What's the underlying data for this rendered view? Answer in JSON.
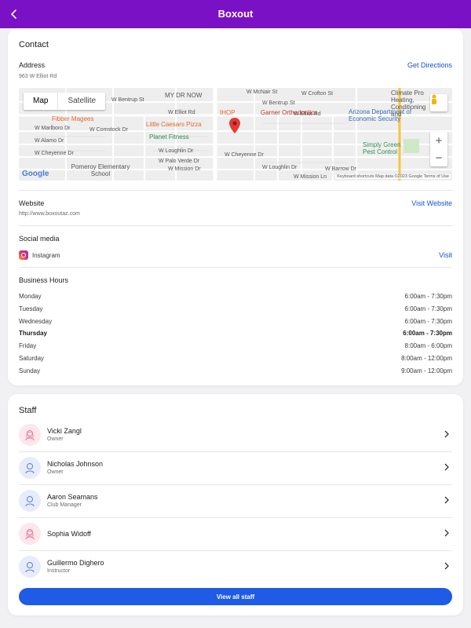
{
  "header": {
    "title": "Boxout"
  },
  "contact": {
    "section_title": "Contact",
    "address_label": "Address",
    "address_value": "963 W Elliot Rd",
    "directions_link": "Get Directions",
    "map": {
      "toggle_map": "Map",
      "toggle_satellite": "Satellite",
      "zoom_in": "+",
      "zoom_out": "−",
      "street_labels": [
        "W Bentrup St",
        "W Elliot Rd",
        "W Comstock Dr",
        "W Marlboro Dr",
        "W Alamo Dr",
        "W Cheyenne Dr",
        "W Loughlin Dr",
        "W Palo Verde Dr",
        "W Mission Dr",
        "W Crofton St",
        "W Bentrup St",
        "W Elliot Rd",
        "W Cheyenne Dr",
        "W Loughlin Dr",
        "W Mission Ln",
        "W Barrow Dr",
        "W McNair St"
      ],
      "pois": [
        "MY DR NOW",
        "IHOP",
        "Garner Orthodontics",
        "Fibber Magees",
        "Little Caesars Pizza",
        "Planet Fitness",
        "Pomeroy Elementary School",
        "Climate Pro Heating, Conditioning and",
        "Arizona Department of Economic Security",
        "Simply Green Pest Control"
      ],
      "google": "Google",
      "attribution": "Keyboard shortcuts   Map data ©2023 Google   Terms of Use"
    },
    "website_label": "Website",
    "website_value": "http://www.boxoutaz.com",
    "website_link": "Visit Website",
    "social_label": "Social media",
    "social_name": "Instagram",
    "social_link": "Visit",
    "hours_title": "Business Hours",
    "hours": [
      {
        "day": "Monday",
        "time": "6:00am - 7:30pm"
      },
      {
        "day": "Tuesday",
        "time": "6:00am - 7:30pm"
      },
      {
        "day": "Wednesday",
        "time": "6:00am - 7:30pm"
      },
      {
        "day": "Thursday",
        "time": "6:00am - 7:30pm"
      },
      {
        "day": "Friday",
        "time": "8:00am - 6:00pm"
      },
      {
        "day": "Saturday",
        "time": "8:00am - 12:00pm"
      },
      {
        "day": "Sunday",
        "time": "9:00am - 12:00pm"
      }
    ]
  },
  "staff": {
    "section_title": "Staff",
    "members": [
      {
        "name": "Vicki Zangl",
        "role": "Owner",
        "avatar": "female"
      },
      {
        "name": "Nicholas Johnson",
        "role": "Owner",
        "avatar": "male"
      },
      {
        "name": "Aaron Seamans",
        "role": "Club Manager",
        "avatar": "male"
      },
      {
        "name": "Sophia Widoff",
        "role": "",
        "avatar": "female"
      },
      {
        "name": "Guillermo Dighero",
        "role": "Instructor",
        "avatar": "male"
      }
    ],
    "view_all": "View all staff"
  },
  "colors": {
    "header": "#7b11c4",
    "link": "#1a4fd8",
    "button": "#1e5be6",
    "female_avatar_bg": "#fde6ec",
    "male_avatar_bg": "#e6ecfb"
  }
}
